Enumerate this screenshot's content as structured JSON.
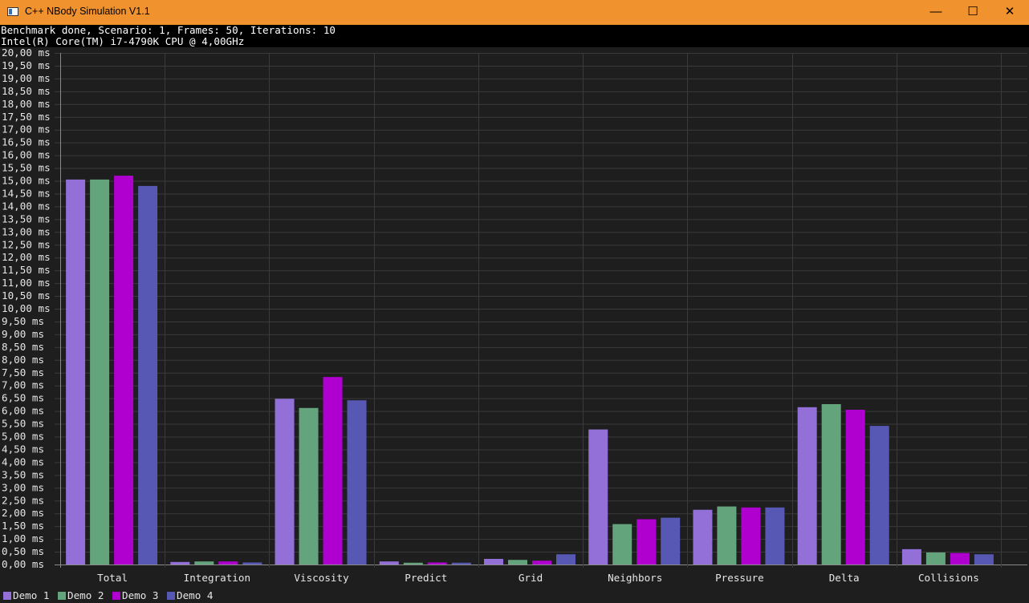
{
  "window": {
    "title": "C++ NBody Simulation V1.1",
    "controls": {
      "minimize": "—",
      "maximize": "☐",
      "close": "✕"
    },
    "icon": "app-window-icon"
  },
  "info": {
    "line1": "Benchmark done, Scenario: 1, Frames: 50, Iterations: 10",
    "line2": "Intel(R) Core(TM) i7-4790K CPU @ 4,00GHz"
  },
  "colors": {
    "titlebar": "#f0922e",
    "background": "#1e1e1e",
    "grid": "#3a3a3a",
    "axis": "#8a8a8a",
    "text": "#e6e6e6"
  },
  "chart_data": {
    "type": "bar",
    "title": "",
    "xlabel": "",
    "ylabel": "",
    "y_unit_suffix": " ms",
    "ylim": [
      0,
      20
    ],
    "ytick_step": 0.5,
    "grid": true,
    "legend_position": "bottom-left",
    "categories": [
      "Total",
      "Integration",
      "Viscosity",
      "Predict",
      "Grid",
      "Neighbors",
      "Pressure",
      "Delta",
      "Collisions"
    ],
    "series": [
      {
        "name": "Demo 1",
        "color": "#9370d8",
        "values": [
          15.05,
          0.1,
          6.48,
          0.12,
          0.22,
          5.28,
          2.14,
          6.15,
          0.6
        ]
      },
      {
        "name": "Demo 2",
        "color": "#63a47c",
        "values": [
          15.05,
          0.12,
          6.12,
          0.07,
          0.18,
          1.58,
          2.27,
          6.27,
          0.47
        ]
      },
      {
        "name": "Demo 3",
        "color": "#b000d0",
        "values": [
          15.2,
          0.12,
          7.33,
          0.08,
          0.15,
          1.77,
          2.23,
          6.05,
          0.45
        ]
      },
      {
        "name": "Demo 4",
        "color": "#5658b4",
        "values": [
          14.8,
          0.08,
          6.42,
          0.07,
          0.4,
          1.83,
          2.23,
          5.42,
          0.4
        ]
      }
    ]
  }
}
